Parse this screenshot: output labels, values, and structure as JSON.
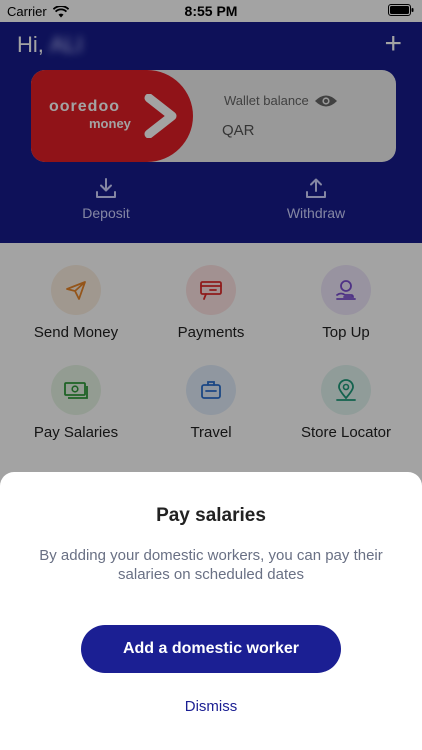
{
  "status_bar": {
    "carrier": "Carrier",
    "time": "8:55 PM"
  },
  "header": {
    "greeting": "Hi,",
    "user_name": "ALI",
    "wallet": {
      "brand_top": "ooredoo",
      "brand_bottom": "money",
      "balance_label": "Wallet balance",
      "currency": "QAR"
    },
    "actions": [
      {
        "label": "Deposit",
        "icon": "download-icon"
      },
      {
        "label": "Withdraw",
        "icon": "upload-icon"
      }
    ]
  },
  "services": [
    {
      "label": "Send Money",
      "icon": "paper-plane-icon"
    },
    {
      "label": "Payments",
      "icon": "payment-icon"
    },
    {
      "label": "Top Up",
      "icon": "top-up-icon"
    },
    {
      "label": "Pay Salaries",
      "icon": "money-stack-icon"
    },
    {
      "label": "Travel",
      "icon": "briefcase-icon"
    },
    {
      "label": "Store Locator",
      "icon": "map-pin-icon"
    }
  ],
  "sheet": {
    "title": "Pay salaries",
    "body": "By adding your domestic workers, you can pay their salaries on scheduled dates",
    "primary_button": "Add a domestic worker",
    "dismiss": "Dismiss"
  },
  "colors": {
    "header_bg": "#161c8c",
    "brand_red": "#e21e26",
    "primary_button": "#1b1f93"
  }
}
